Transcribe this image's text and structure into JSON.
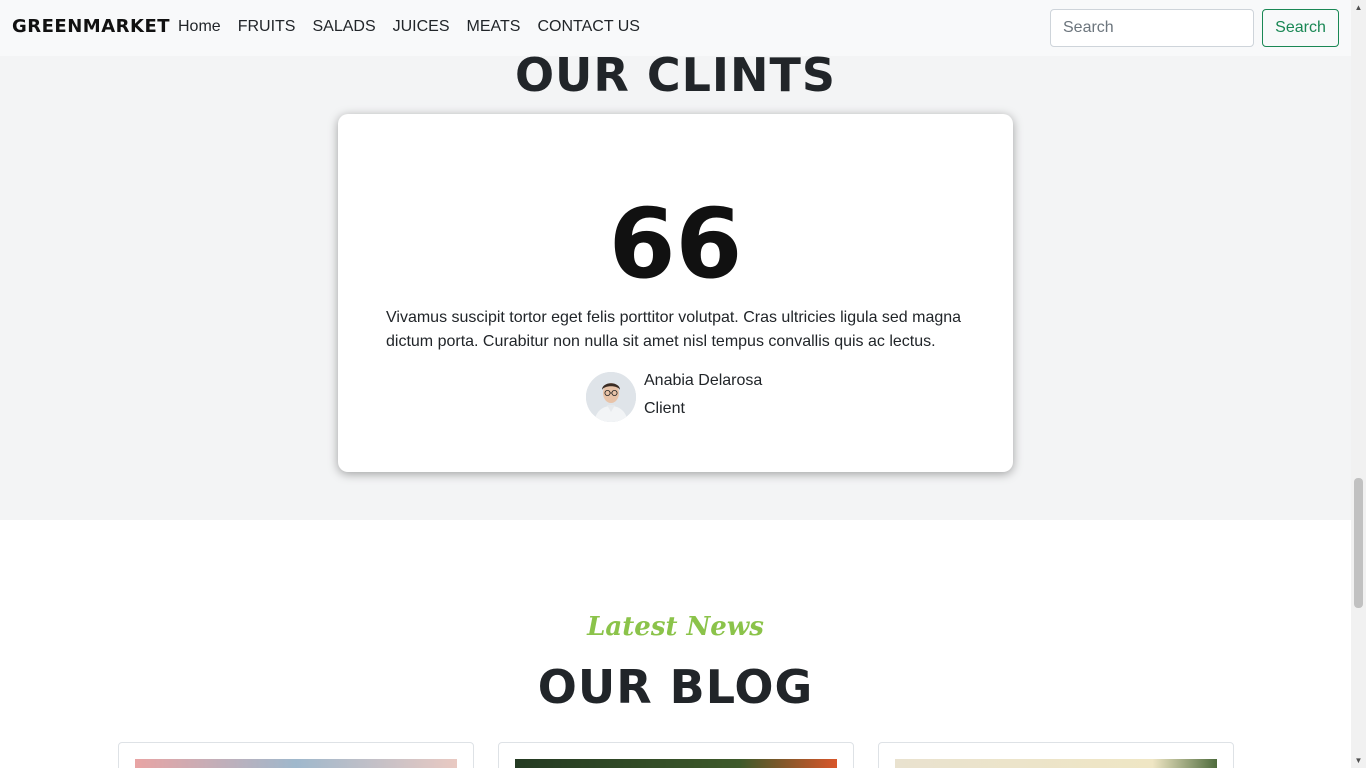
{
  "navbar": {
    "brand": "GREENMARKET",
    "links": [
      "Home",
      "FRUITS",
      "SALADS",
      "JUICES",
      "MEATS",
      "CONTACT US"
    ],
    "search_placeholder": "Search",
    "search_button": "Search",
    "search_button_color": "#198754"
  },
  "clients": {
    "title": "OUR CLINTS",
    "quote_mark": "66",
    "text": "Vivamus suscipit tortor eget felis porttitor volutpat. Cras ultricies ligula sed magna dictum porta. Curabitur non nulla sit amet nisl tempus convallis quis ac lectus.",
    "author_name": "Anabia Delarosa",
    "author_role": "Client"
  },
  "blog": {
    "eyebrow": "Latest News",
    "eyebrow_color": "#8bc34a",
    "title": "OUR BLOG"
  }
}
